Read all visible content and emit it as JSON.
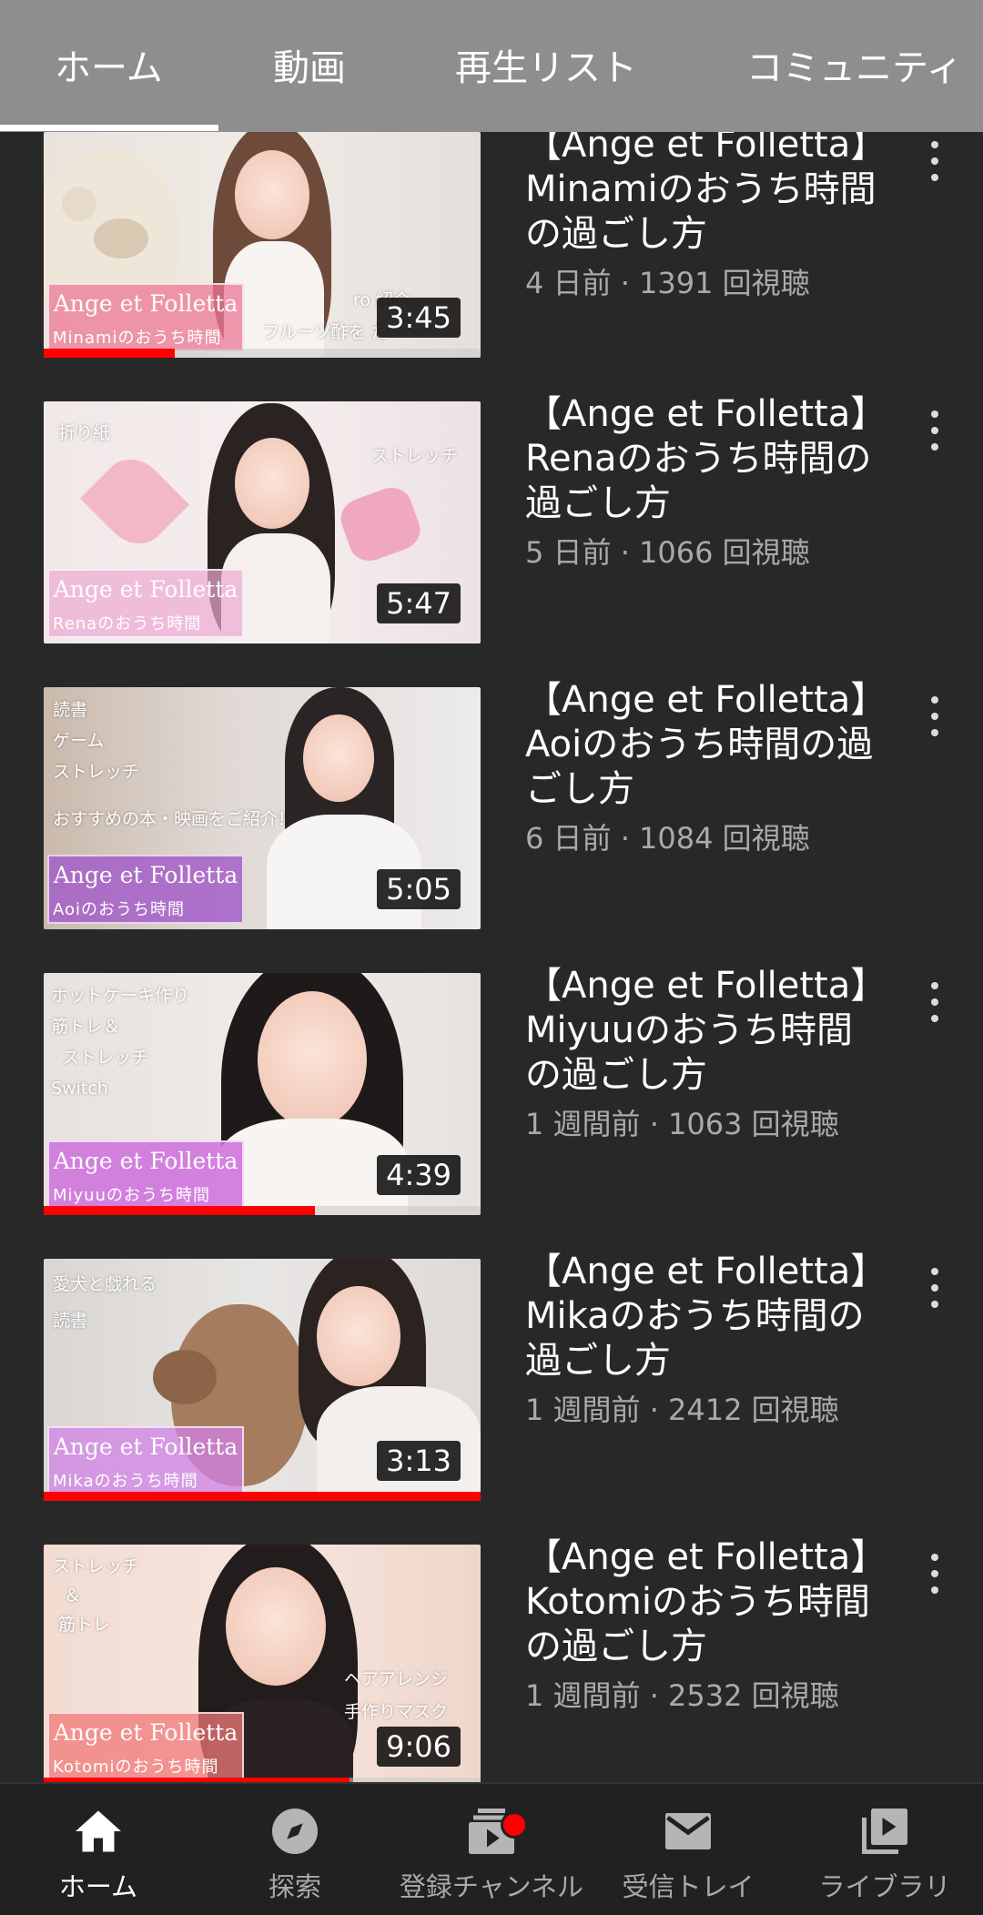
{
  "tabs": [
    {
      "label": "ホーム",
      "active": true
    },
    {
      "label": "動画",
      "active": false
    },
    {
      "label": "再生リスト",
      "active": false
    },
    {
      "label": "コミュニティ",
      "active": false
    }
  ],
  "videos": [
    {
      "title": "【Ange et Folletta】\nMinamiのおうち時間\nの過ごし方",
      "subtitle": "4 日前 · 1391 回視聴",
      "duration": "3:45",
      "thumb_line1": "Ange et Folletta",
      "thumb_line2": "Minamiのおうち時間",
      "deco1": "ro    紹介",
      "deco2": "フルーツ酢を    た",
      "progress": 0.3
    },
    {
      "title": "【Ange et Folletta】\nRenaのおうち時間の\n過ごし方",
      "subtitle": "5 日前 · 1066 回視聴",
      "duration": "5:47",
      "thumb_line1": "Ange et Folletta",
      "thumb_line2": "Renaのおうち時間",
      "deco1": "折り紙",
      "deco2": "ストレッチ",
      "progress": 0
    },
    {
      "title": "【Ange et Folletta】\nAoiのおうち時間の過\nごし方",
      "subtitle": "6 日前 · 1084 回視聴",
      "duration": "5:05",
      "thumb_line1": "Ange et Folletta",
      "thumb_line2": "Aoiのおうち時間",
      "deco1": "読書\nゲーム\nストレッチ",
      "deco2": "おすすめの本・映画をご紹介！",
      "progress": 0
    },
    {
      "title": "【Ange et Folletta】\nMiyuuのおうち時間\nの過ごし方",
      "subtitle": "1 週間前 · 1063 回視聴",
      "duration": "4:39",
      "thumb_line1": "Ange et Folletta",
      "thumb_line2": "Miyuuのおうち時間",
      "deco1": "ホットケーキ作り\n筋トレ＆\n  ストレッチ\nSwitch",
      "deco2": "",
      "progress": 0.62
    },
    {
      "title": "【Ange et Folletta】\nMikaのおうち時間の\n過ごし方",
      "subtitle": "1 週間前 · 2412 回視聴",
      "duration": "3:13",
      "thumb_line1": "Ange et Folletta",
      "thumb_line2": "Mikaのおうち時間",
      "deco1": "愛犬と戯れる\n読書",
      "deco2": "",
      "progress": 1.0
    },
    {
      "title": "【Ange et Folletta】\nKotomiのおうち時間\nの過ごし方",
      "subtitle": "1 週間前 · 2532 回視聴",
      "duration": "9:06",
      "thumb_line1": "Ange et Folletta",
      "thumb_line2": "Kotomiのおうち時間",
      "deco1": "ストレッチ\n  ＆\n 筋トレ",
      "deco2": "ヘアアレンジ\n手作りマスク",
      "progress": 0.7
    }
  ],
  "bottom_nav": [
    {
      "label": "ホーム",
      "icon": "home-icon",
      "active": true
    },
    {
      "label": "探索",
      "icon": "explore-icon",
      "active": false
    },
    {
      "label": "登録チャンネル",
      "icon": "subscriptions-icon",
      "active": false,
      "badge": true
    },
    {
      "label": "受信トレイ",
      "icon": "inbox-icon",
      "active": false
    },
    {
      "label": "ライブラリ",
      "icon": "library-icon",
      "active": false
    }
  ],
  "colors": {
    "background": "#282828",
    "tab_bar": "#8e8e8e",
    "progress": "#ff0000",
    "secondary_text": "#aaaaaa"
  }
}
